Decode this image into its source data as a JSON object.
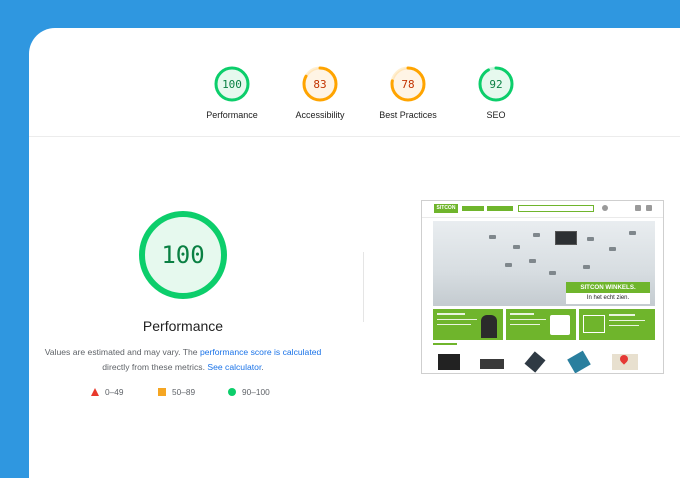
{
  "gauges": [
    {
      "score": "100",
      "label": "Performance",
      "color": "#0cce6b",
      "text_color": "#0a8043",
      "fill": "#e6f9ee",
      "value": 100
    },
    {
      "score": "83",
      "label": "Accessibility",
      "color": "#ffa400",
      "text_color": "#c33300",
      "fill": "#fff4e5",
      "value": 83
    },
    {
      "score": "78",
      "label": "Best Practices",
      "color": "#ffa400",
      "text_color": "#c33300",
      "fill": "#fff4e5",
      "value": 78
    },
    {
      "score": "92",
      "label": "SEO",
      "color": "#0cce6b",
      "text_color": "#0a8043",
      "fill": "#e6f9ee",
      "value": 92
    }
  ],
  "main": {
    "score": "100",
    "title": "Performance",
    "desc_prefix": "Values are estimated and may vary. The ",
    "desc_link1": "performance score is calculated",
    "desc_middle": "directly from these metrics. ",
    "desc_link2": "See calculator",
    "desc_suffix": "."
  },
  "legend": [
    {
      "label": "0–49",
      "shape": "triangle",
      "color": "#e8392c"
    },
    {
      "label": "50–89",
      "shape": "square",
      "color": "#f5a623"
    },
    {
      "label": "90–100",
      "shape": "circle",
      "color": "#0cce6b"
    }
  ],
  "screenshot": {
    "logo": "SITCON",
    "banner_line1": "SITCON WINKELS.",
    "banner_line2": "In het echt zien."
  }
}
